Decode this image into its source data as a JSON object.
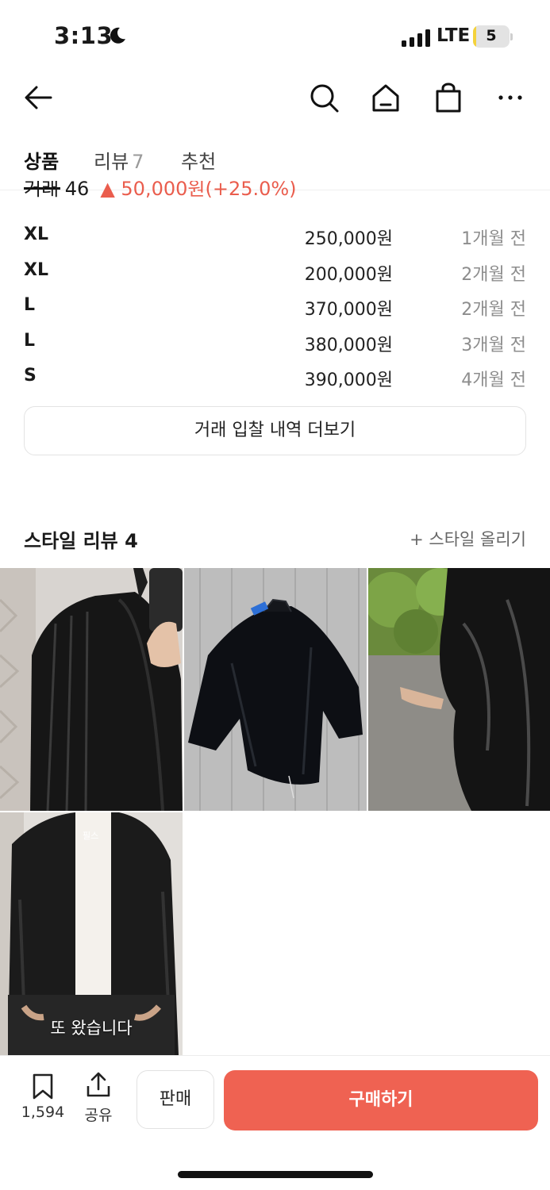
{
  "status_bar": {
    "time": "3:13",
    "network": "LTE",
    "battery_level": "5",
    "battery_fraction": 0.05
  },
  "tabs": [
    {
      "label": "상품",
      "active": true
    },
    {
      "label": "리뷰",
      "count": "7",
      "active": false
    },
    {
      "label": "추천",
      "active": false
    }
  ],
  "cut_row": {
    "label": "거래 46",
    "change": "▲ 50,000원(+25.0%)"
  },
  "trades": [
    {
      "size": "XL",
      "price": "250,000원",
      "time": "1개월 전"
    },
    {
      "size": "XL",
      "price": "200,000원",
      "time": "2개월 전"
    },
    {
      "size": "L",
      "price": "370,000원",
      "time": "2개월 전"
    },
    {
      "size": "L",
      "price": "380,000원",
      "time": "3개월 전"
    },
    {
      "size": "S",
      "price": "390,000원",
      "time": "4개월 전"
    }
  ],
  "more_button": "거래 입찰 내역 더보기",
  "style_review": {
    "title": "스타일 리뷰 4",
    "upload": "+ 스타일 올리기",
    "photo_caption": "또 왔습니다",
    "shirt_text": "필스"
  },
  "bottom_bar": {
    "save_count": "1,594",
    "share_label": "공유",
    "sell_label": "판매",
    "buy_label": "구매하기"
  },
  "colors": {
    "accent": "#ef6252",
    "price_up": "#ea5d4d"
  }
}
